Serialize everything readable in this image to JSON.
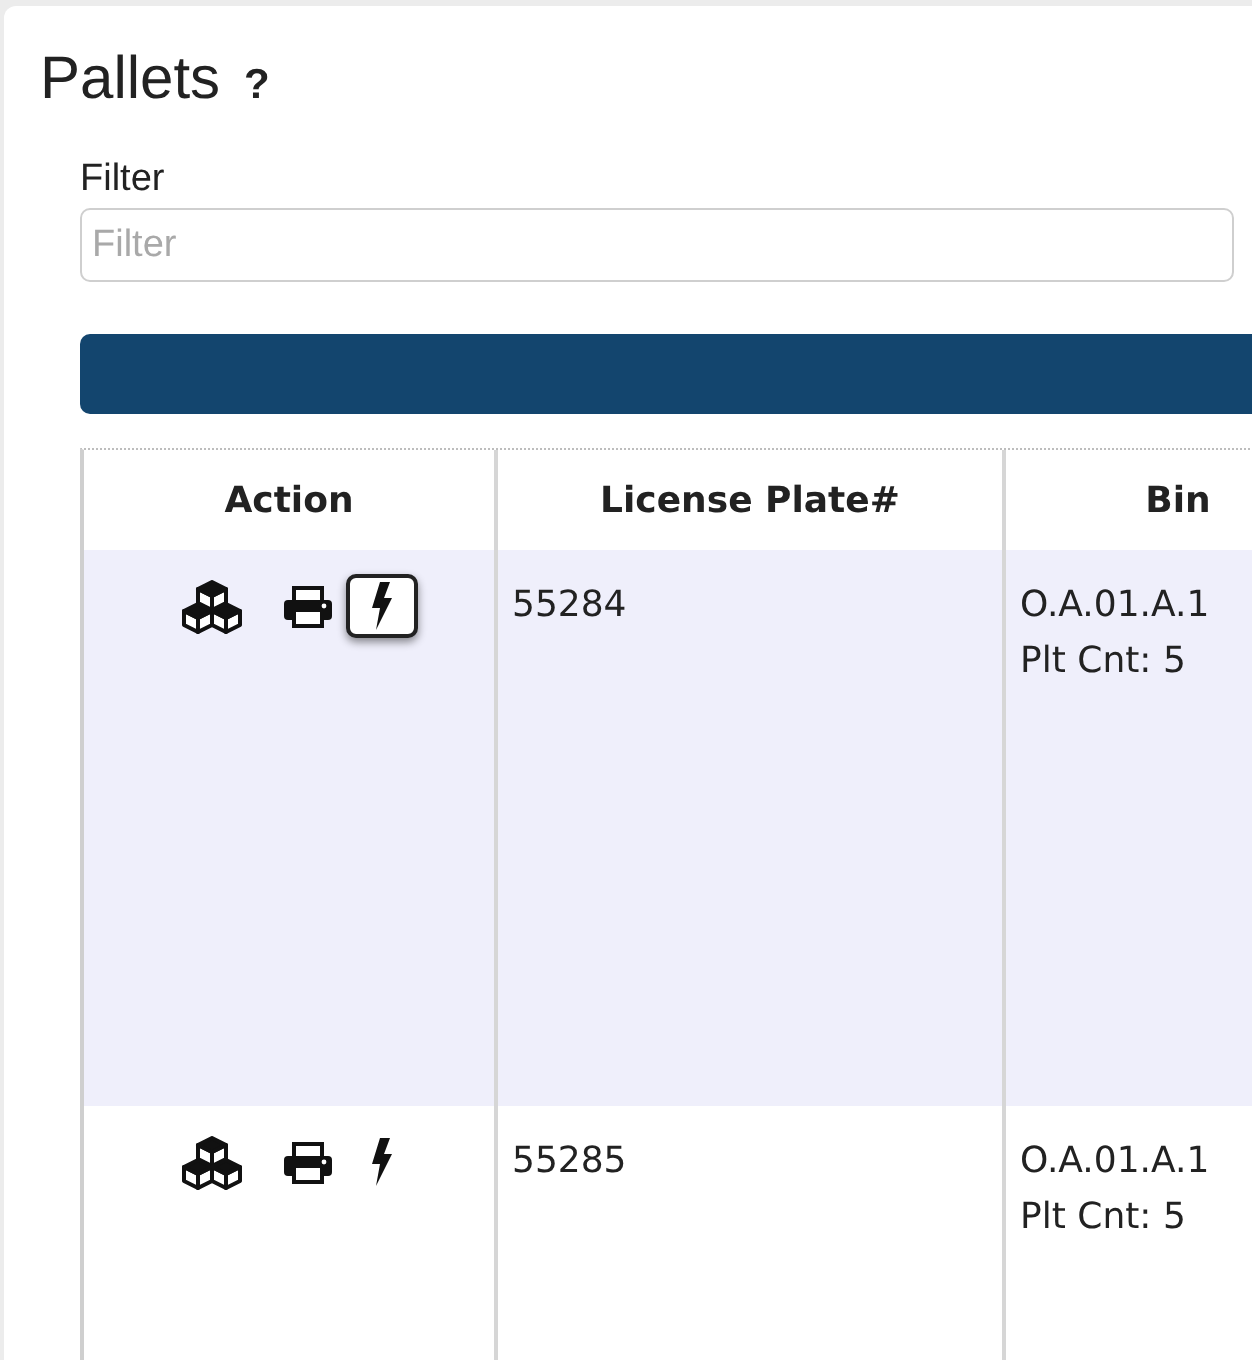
{
  "page": {
    "title": "Pallets",
    "help": "?"
  },
  "filter": {
    "label": "Filter",
    "placeholder": "Filter"
  },
  "table": {
    "columns": [
      "Action",
      "License Plate#",
      "Bin"
    ],
    "rows": [
      {
        "selected": true,
        "actions": [
          {
            "kind": "cubes",
            "focused": false
          },
          {
            "kind": "printer",
            "focused": false
          },
          {
            "kind": "bolt",
            "focused": true
          }
        ],
        "license_plate": "55284",
        "bin": "O.A.01.A.1",
        "count": "Plt Cnt: 5"
      },
      {
        "selected": false,
        "actions": [
          {
            "kind": "cubes",
            "focused": false
          },
          {
            "kind": "printer",
            "focused": false
          },
          {
            "kind": "bolt",
            "focused": false
          }
        ],
        "license_plate": "55285",
        "bin": "O.A.01.A.1",
        "count": "Plt Cnt: 5"
      }
    ]
  }
}
